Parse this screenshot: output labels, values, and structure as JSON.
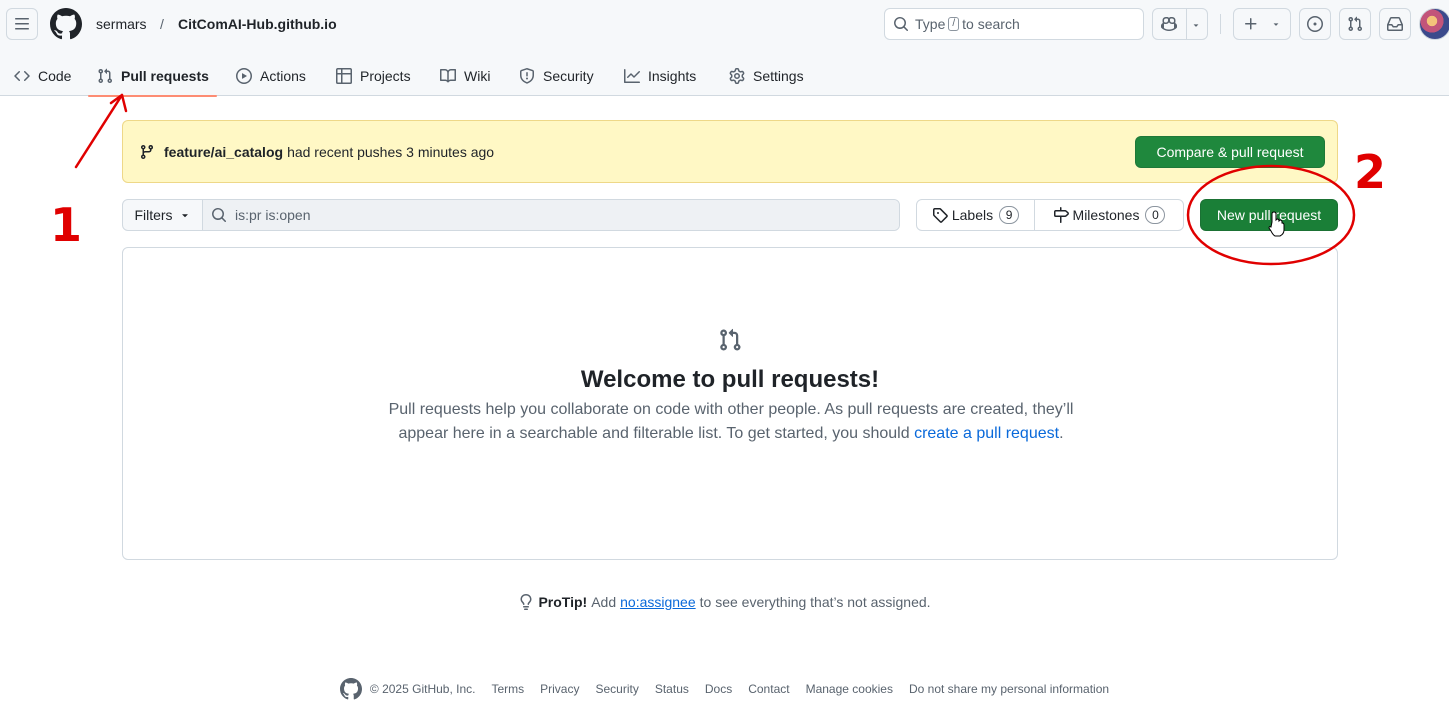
{
  "header": {
    "owner": "sermars",
    "separator": "/",
    "repo": "CitComAI-Hub.github.io",
    "search": {
      "prefix": "Type",
      "key": "/",
      "suffix": "to search"
    }
  },
  "tabs": [
    {
      "label": "Code",
      "icon": "code-icon"
    },
    {
      "label": "Pull requests",
      "icon": "git-pull-request-icon",
      "active": true
    },
    {
      "label": "Actions",
      "icon": "play-icon"
    },
    {
      "label": "Projects",
      "icon": "table-icon"
    },
    {
      "label": "Wiki",
      "icon": "book-icon"
    },
    {
      "label": "Security",
      "icon": "shield-icon"
    },
    {
      "label": "Insights",
      "icon": "graph-icon"
    },
    {
      "label": "Settings",
      "icon": "gear-icon"
    }
  ],
  "banner": {
    "branch": "feature/ai_catalog",
    "message": "had recent pushes 3 minutes ago",
    "compare_label": "Compare & pull request"
  },
  "filters": {
    "filters_label": "Filters",
    "query": "is:pr is:open",
    "labels_label": "Labels",
    "labels_count": "9",
    "milestones_label": "Milestones",
    "milestones_count": "0",
    "new_pr_label": "New pull request"
  },
  "blankslate": {
    "title": "Welcome to pull requests!",
    "text": "Pull requests help you collaborate on code with other people. As pull requests are created, they’ll appear here in a searchable and filterable list. To get started, you should",
    "link": "create a pull request",
    "end": "."
  },
  "protip": {
    "bold": "ProTip!",
    "pre": "Add",
    "link": "no:assignee",
    "post": "to see everything that’s not assigned."
  },
  "footer": {
    "copyright": "© 2025 GitHub, Inc.",
    "links": [
      "Terms",
      "Privacy",
      "Security",
      "Status",
      "Docs",
      "Contact",
      "Manage cookies",
      "Do not share my personal information"
    ]
  },
  "annotations": {
    "one": "1",
    "two": "2"
  },
  "colors": {
    "primary_green": "#1f883d",
    "banner_bg": "#fff8c5",
    "active_tab_underline": "#fd8c73",
    "annotation": "#e00000"
  }
}
